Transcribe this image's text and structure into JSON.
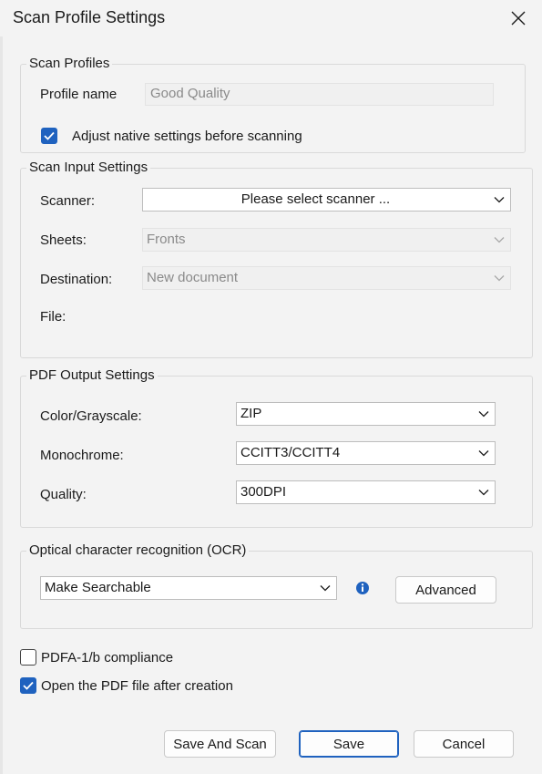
{
  "window": {
    "title": "Scan Profile Settings"
  },
  "scan_profiles": {
    "legend": "Scan Profiles",
    "profile_name_label": "Profile name",
    "profile_name_value": "Good Quality",
    "adjust_native_label": "Adjust native settings before scanning",
    "adjust_native_checked": true
  },
  "scan_input": {
    "legend": "Scan Input Settings",
    "scanner_label": "Scanner:",
    "scanner_value": "Please select scanner ...",
    "sheets_label": "Sheets:",
    "sheets_value": "Fronts",
    "destination_label": "Destination:",
    "destination_value": "New document",
    "file_label": "File:"
  },
  "pdf_output": {
    "legend": "PDF Output Settings",
    "color_label": "Color/Grayscale:",
    "color_value": "ZIP",
    "mono_label": "Monochrome:",
    "mono_value": "CCITT3/CCITT4",
    "quality_label": "Quality:",
    "quality_value": "300DPI"
  },
  "ocr": {
    "legend": "Optical character recognition (OCR)",
    "mode_value": "Make Searchable",
    "advanced_label": "Advanced"
  },
  "options": {
    "pdfa_label": "PDFA-1/b compliance",
    "pdfa_checked": false,
    "open_pdf_label": "Open the PDF file after creation",
    "open_pdf_checked": true
  },
  "buttons": {
    "save_and_scan": "Save And Scan",
    "save": "Save",
    "cancel": "Cancel"
  },
  "colors": {
    "accent": "#1f62bf",
    "background": "#f3f3f3",
    "info_icon": "#1f62bf"
  }
}
